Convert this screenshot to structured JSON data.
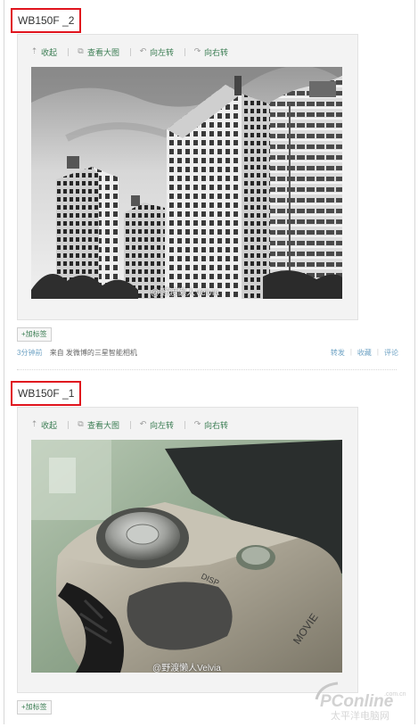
{
  "posts": [
    {
      "title": "WB150F _2",
      "toolbar": [
        "收起",
        "查看大图",
        "向左转",
        "向右转"
      ],
      "watermark": "@野渡懒人Velvia",
      "tag_button": "+加标签",
      "time": "3分钟前",
      "source": "来自 发微博的三星智能相机",
      "actions": [
        "转发",
        "收藏",
        "评论"
      ]
    },
    {
      "title": "WB150F _1",
      "toolbar": [
        "收起",
        "查看大图",
        "向左转",
        "向右转"
      ],
      "watermark": "@野渡懒人Velvia",
      "tag_button": "+加标签"
    }
  ],
  "logo": {
    "brand": "PConline",
    "sub": "太平洋电脑网",
    "domain": ".com.cn"
  },
  "colors": {
    "link_green": "#3b7d53",
    "title_border": "#e0141e",
    "meta_blue": "#6fa3c4",
    "card_bg": "#f3f3f3"
  },
  "icons": [
    "collapse-icon",
    "view-large-icon",
    "rotate-left-icon",
    "rotate-right-icon"
  ]
}
